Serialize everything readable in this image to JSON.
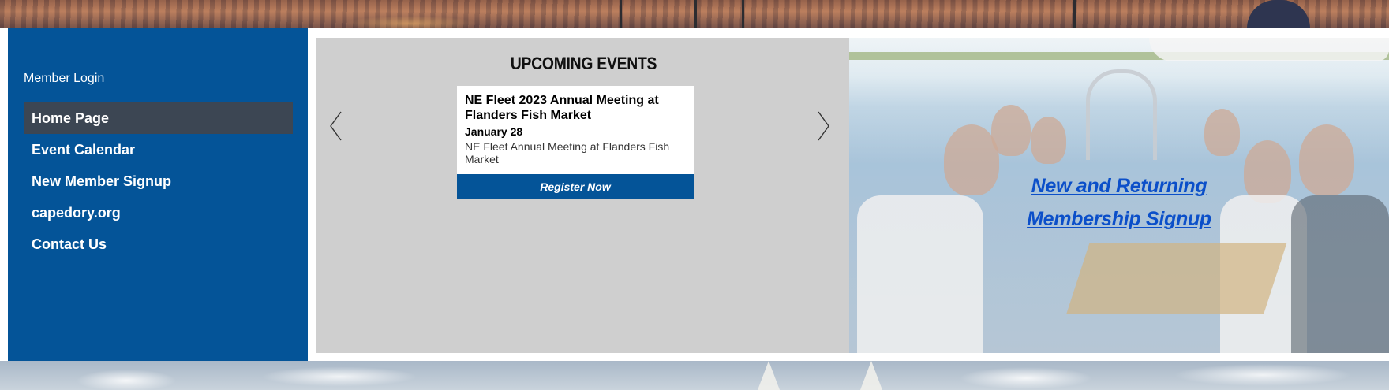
{
  "sidebar": {
    "member_login": "Member Login",
    "items": [
      {
        "label": "Home Page",
        "active": true
      },
      {
        "label": "Event Calendar",
        "active": false
      },
      {
        "label": "New Member Signup",
        "active": false
      },
      {
        "label": "capedory.org",
        "active": false
      },
      {
        "label": "Contact Us",
        "active": false
      }
    ]
  },
  "events": {
    "title": "UPCOMING EVENTS",
    "card": {
      "title": "NE Fleet 2023 Annual Meeting at Flanders Fish Market",
      "date": "January 28",
      "description": "NE Fleet Annual Meeting at Flanders Fish Market",
      "button_label": "Register Now"
    },
    "prev_icon": "chevron-left-icon",
    "next_icon": "chevron-right-icon"
  },
  "promo": {
    "link_line1": "New and Returning",
    "link_line2": "Membership Signup"
  },
  "colors": {
    "brand_blue": "#045498",
    "active_nav": "#3c4653",
    "panel_gray": "#cfcfcf",
    "link_blue": "#0b4fc9"
  }
}
